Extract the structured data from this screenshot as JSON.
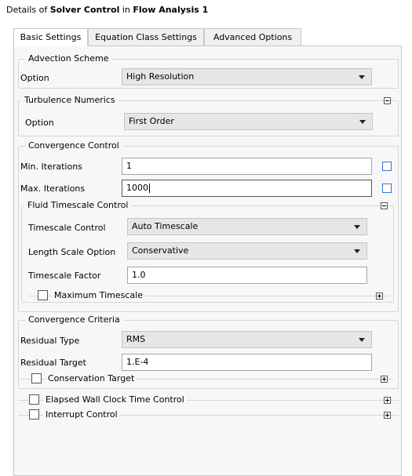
{
  "header": {
    "prefix": "Details of ",
    "object": "Solver Control",
    "middle": " in ",
    "context": "Flow Analysis 1"
  },
  "tabs": [
    {
      "label": "Basic Settings",
      "active": true
    },
    {
      "label": "Equation Class Settings",
      "active": false
    },
    {
      "label": "Advanced Options",
      "active": false
    }
  ],
  "advection": {
    "title": "Advection Scheme",
    "option_label": "Option",
    "option_value": "High Resolution"
  },
  "turbulence": {
    "title": "Turbulence Numerics",
    "option_label": "Option",
    "option_value": "First Order"
  },
  "convergence_control": {
    "title": "Convergence Control",
    "min_iter_label": "Min. Iterations",
    "min_iter_value": "1",
    "max_iter_label": "Max. Iterations",
    "max_iter_value": "1000",
    "fluid_timescale": {
      "title": "Fluid Timescale Control",
      "timescale_control_label": "Timescale Control",
      "timescale_control_value": "Auto Timescale",
      "length_scale_label": "Length Scale Option",
      "length_scale_value": "Conservative",
      "factor_label": "Timescale Factor",
      "factor_value": "1.0",
      "max_timescale_label": "Maximum Timescale"
    }
  },
  "convergence_criteria": {
    "title": "Convergence Criteria",
    "residual_type_label": "Residual Type",
    "residual_type_value": "RMS",
    "residual_target_label": "Residual Target",
    "residual_target_value": "1.E-4",
    "conservation_target_label": "Conservation Target"
  },
  "extra_options": {
    "elapsed_wall_clock": "Elapsed Wall Clock Time Control",
    "interrupt_control": "Interrupt Control"
  },
  "colors": {
    "expression_toggle": "#3a6fd8",
    "panel_bg": "#f7f7f7",
    "dropdown_bg": "#e6e6e6"
  }
}
